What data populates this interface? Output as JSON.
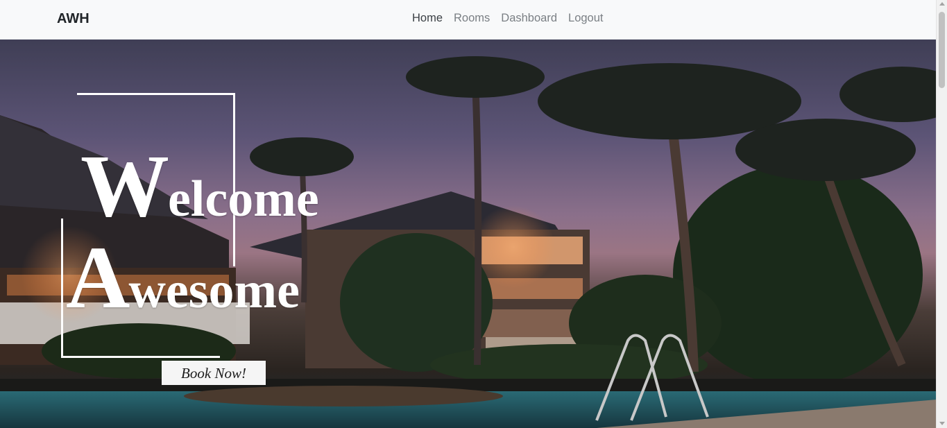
{
  "navbar": {
    "brand": "AWH",
    "links": [
      {
        "label": "Home",
        "active": true
      },
      {
        "label": "Rooms",
        "active": false
      },
      {
        "label": "Dashboard",
        "active": false
      },
      {
        "label": "Logout",
        "active": false
      }
    ]
  },
  "hero": {
    "welcome_cap": "W",
    "welcome_rest": "elcome",
    "awesome_cap": "A",
    "awesome_rest": "wesome",
    "cta_label": "Book Now!"
  },
  "colors": {
    "navbar_bg": "#f8f9fa",
    "brand_text": "#212529",
    "nav_link": "#7a7f84",
    "nav_link_active": "#3a3f44",
    "hero_text": "#ffffff",
    "cta_bg": "#f5f5f5"
  }
}
